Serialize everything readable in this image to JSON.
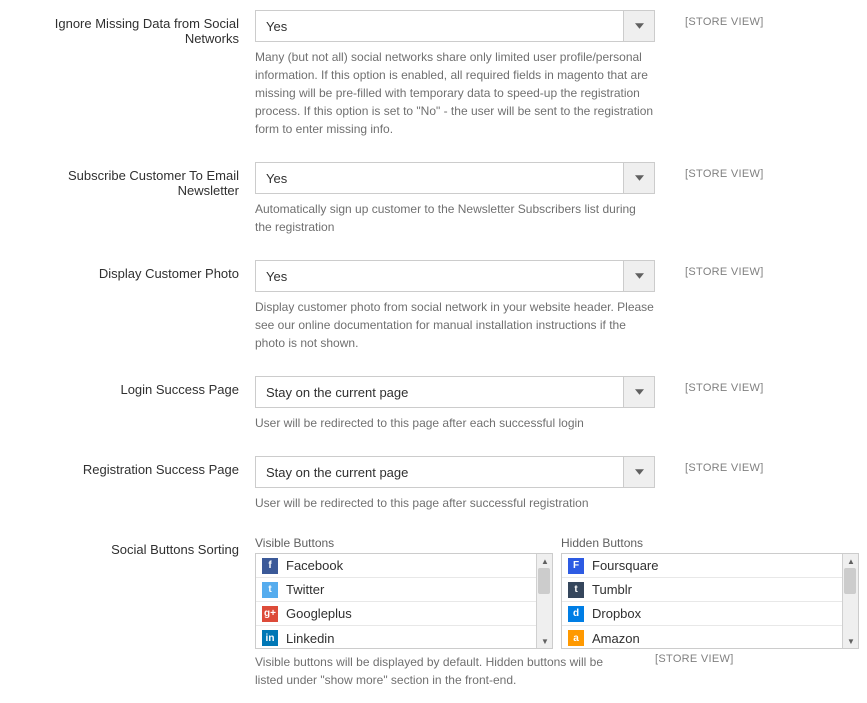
{
  "scope": "[STORE VIEW]",
  "fields": {
    "ignore_missing": {
      "label": "Ignore Missing Data from Social Networks",
      "value": "Yes",
      "help": "Many (but not all) social networks share only limited user profile/personal information. If this option is enabled, all required fields in magento that are missing will be pre-filled with temporary data to speed-up the registration process. If this option is set to \"No\" - the user will be sent to the registration form to enter missing info."
    },
    "subscribe_newsletter": {
      "label": "Subscribe Customer To Email Newsletter",
      "value": "Yes",
      "help": "Automatically sign up customer to the Newsletter Subscribers list during the registration"
    },
    "display_photo": {
      "label": "Display Customer Photo",
      "value": "Yes",
      "help": "Display customer photo from social network in your website header. Please see our online documentation for manual installation instructions if the photo is not shown."
    },
    "login_success": {
      "label": "Login Success Page",
      "value": "Stay on the current page",
      "help": "User will be redirected to this page after each successful login"
    },
    "registration_success": {
      "label": "Registration Success Page",
      "value": "Stay on the current page",
      "help": "User will be redirected to this page after successful registration"
    },
    "social_sorting": {
      "label": "Social Buttons Sorting",
      "visible_header": "Visible Buttons",
      "hidden_header": "Hidden Buttons",
      "help": "Visible buttons will be displayed by default. Hidden buttons will be listed under \"show more\" section in the front-end.",
      "visible": [
        {
          "name": "Facebook",
          "icon": "f",
          "iconClass": "icon-facebook"
        },
        {
          "name": "Twitter",
          "icon": "t",
          "iconClass": "icon-twitter"
        },
        {
          "name": "Googleplus",
          "icon": "g+",
          "iconClass": "icon-googleplus"
        },
        {
          "name": "Linkedin",
          "icon": "in",
          "iconClass": "icon-linkedin"
        }
      ],
      "hidden": [
        {
          "name": "Foursquare",
          "icon": "F",
          "iconClass": "icon-foursquare"
        },
        {
          "name": "Tumblr",
          "icon": "t",
          "iconClass": "icon-tumblr"
        },
        {
          "name": "Dropbox",
          "icon": "d",
          "iconClass": "icon-dropbox"
        },
        {
          "name": "Amazon",
          "icon": "a",
          "iconClass": "icon-amazon"
        }
      ]
    }
  }
}
